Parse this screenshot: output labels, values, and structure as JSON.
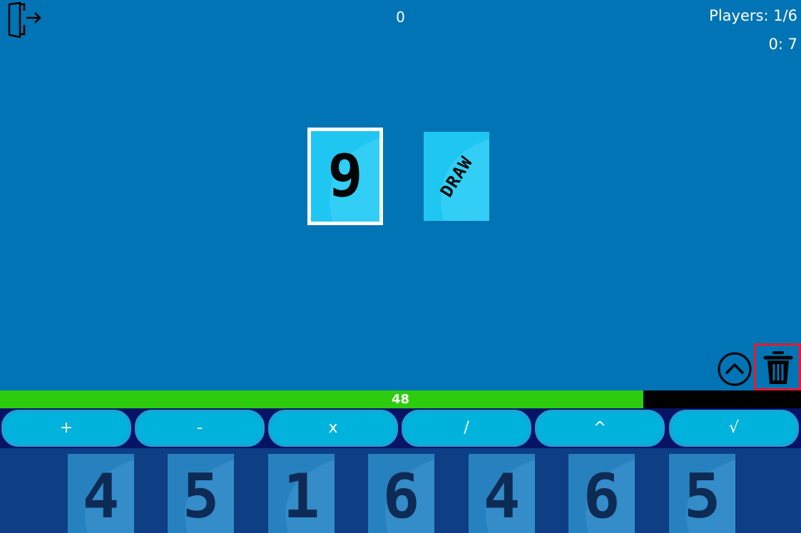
{
  "header": {
    "score": "0",
    "players": "Players: 1/6",
    "timer": "0: 7"
  },
  "table": {
    "played_card": "9",
    "draw_card": "DRAW"
  },
  "timer_bar": {
    "label": "48",
    "fill_fraction": 0.803
  },
  "operators": [
    "+",
    "-",
    "x",
    "/",
    "^",
    "√"
  ],
  "hand": [
    "4",
    "5",
    "1",
    "6",
    "4",
    "6",
    "5"
  ],
  "icons": {
    "exit": "exit-door-icon",
    "expand": "chevron-up-circle-icon",
    "discard": "trash-icon"
  },
  "colors": {
    "background": "#0074b4",
    "card_face": "#1fc6f2",
    "timer_fill": "#2ecc0e",
    "operator_button": "#00b3dd",
    "hand_bar": "#0d3e86",
    "selection_outline": "#e8192c"
  }
}
